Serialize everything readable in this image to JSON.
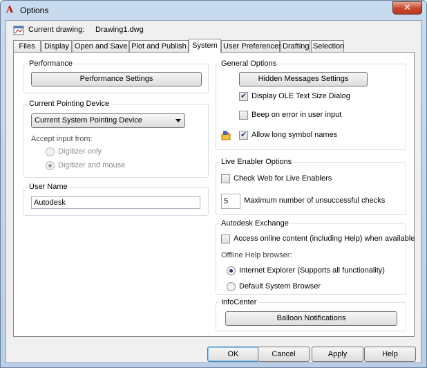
{
  "window": {
    "title": "Options",
    "close_glyph": "✕"
  },
  "drawing": {
    "label": "Current drawing:",
    "name": "Drawing1.dwg"
  },
  "tabs": [
    {
      "label": "Files",
      "active": false
    },
    {
      "label": "Display",
      "active": false
    },
    {
      "label": "Open and Save",
      "active": false
    },
    {
      "label": "Plot and Publish",
      "active": false
    },
    {
      "label": "System",
      "active": true
    },
    {
      "label": "User Preferences",
      "active": false
    },
    {
      "label": "Drafting",
      "active": false
    },
    {
      "label": "Selection",
      "active": false
    }
  ],
  "performance": {
    "title": "Performance",
    "button": "Performance Settings"
  },
  "pointing": {
    "title": "Current Pointing Device",
    "selected": "Current System Pointing Device",
    "accept_label": "Accept input from:",
    "radio1": "Digitizer only",
    "radio2": "Digitizer and mouse"
  },
  "username": {
    "title": "User Name",
    "value": "Autodesk"
  },
  "general": {
    "title": "General Options",
    "hidden_button": "Hidden Messages Settings",
    "ole": "Display OLE Text Size Dialog",
    "beep": "Beep on error in user input",
    "long_names": "Allow long symbol names"
  },
  "live": {
    "title": "Live Enabler Options",
    "check_web": "Check Web for Live Enablers",
    "max_value": "5",
    "max_label": "Maximum number of unsuccessful checks"
  },
  "exchange": {
    "title": "Autodesk Exchange",
    "online": "Access online content (including Help) when available",
    "offline_label": "Offline Help browser:",
    "ie": "Internet Explorer (Supports all functionality)",
    "default_browser": "Default System Browser"
  },
  "infocenter": {
    "title": "InfoCenter",
    "button": "Balloon Notifications"
  },
  "buttons": {
    "ok": "OK",
    "cancel": "Cancel",
    "apply": "Apply",
    "help": "Help"
  },
  "colors": {
    "accent": "#3c7fb1",
    "title_close": "#c7452b"
  }
}
